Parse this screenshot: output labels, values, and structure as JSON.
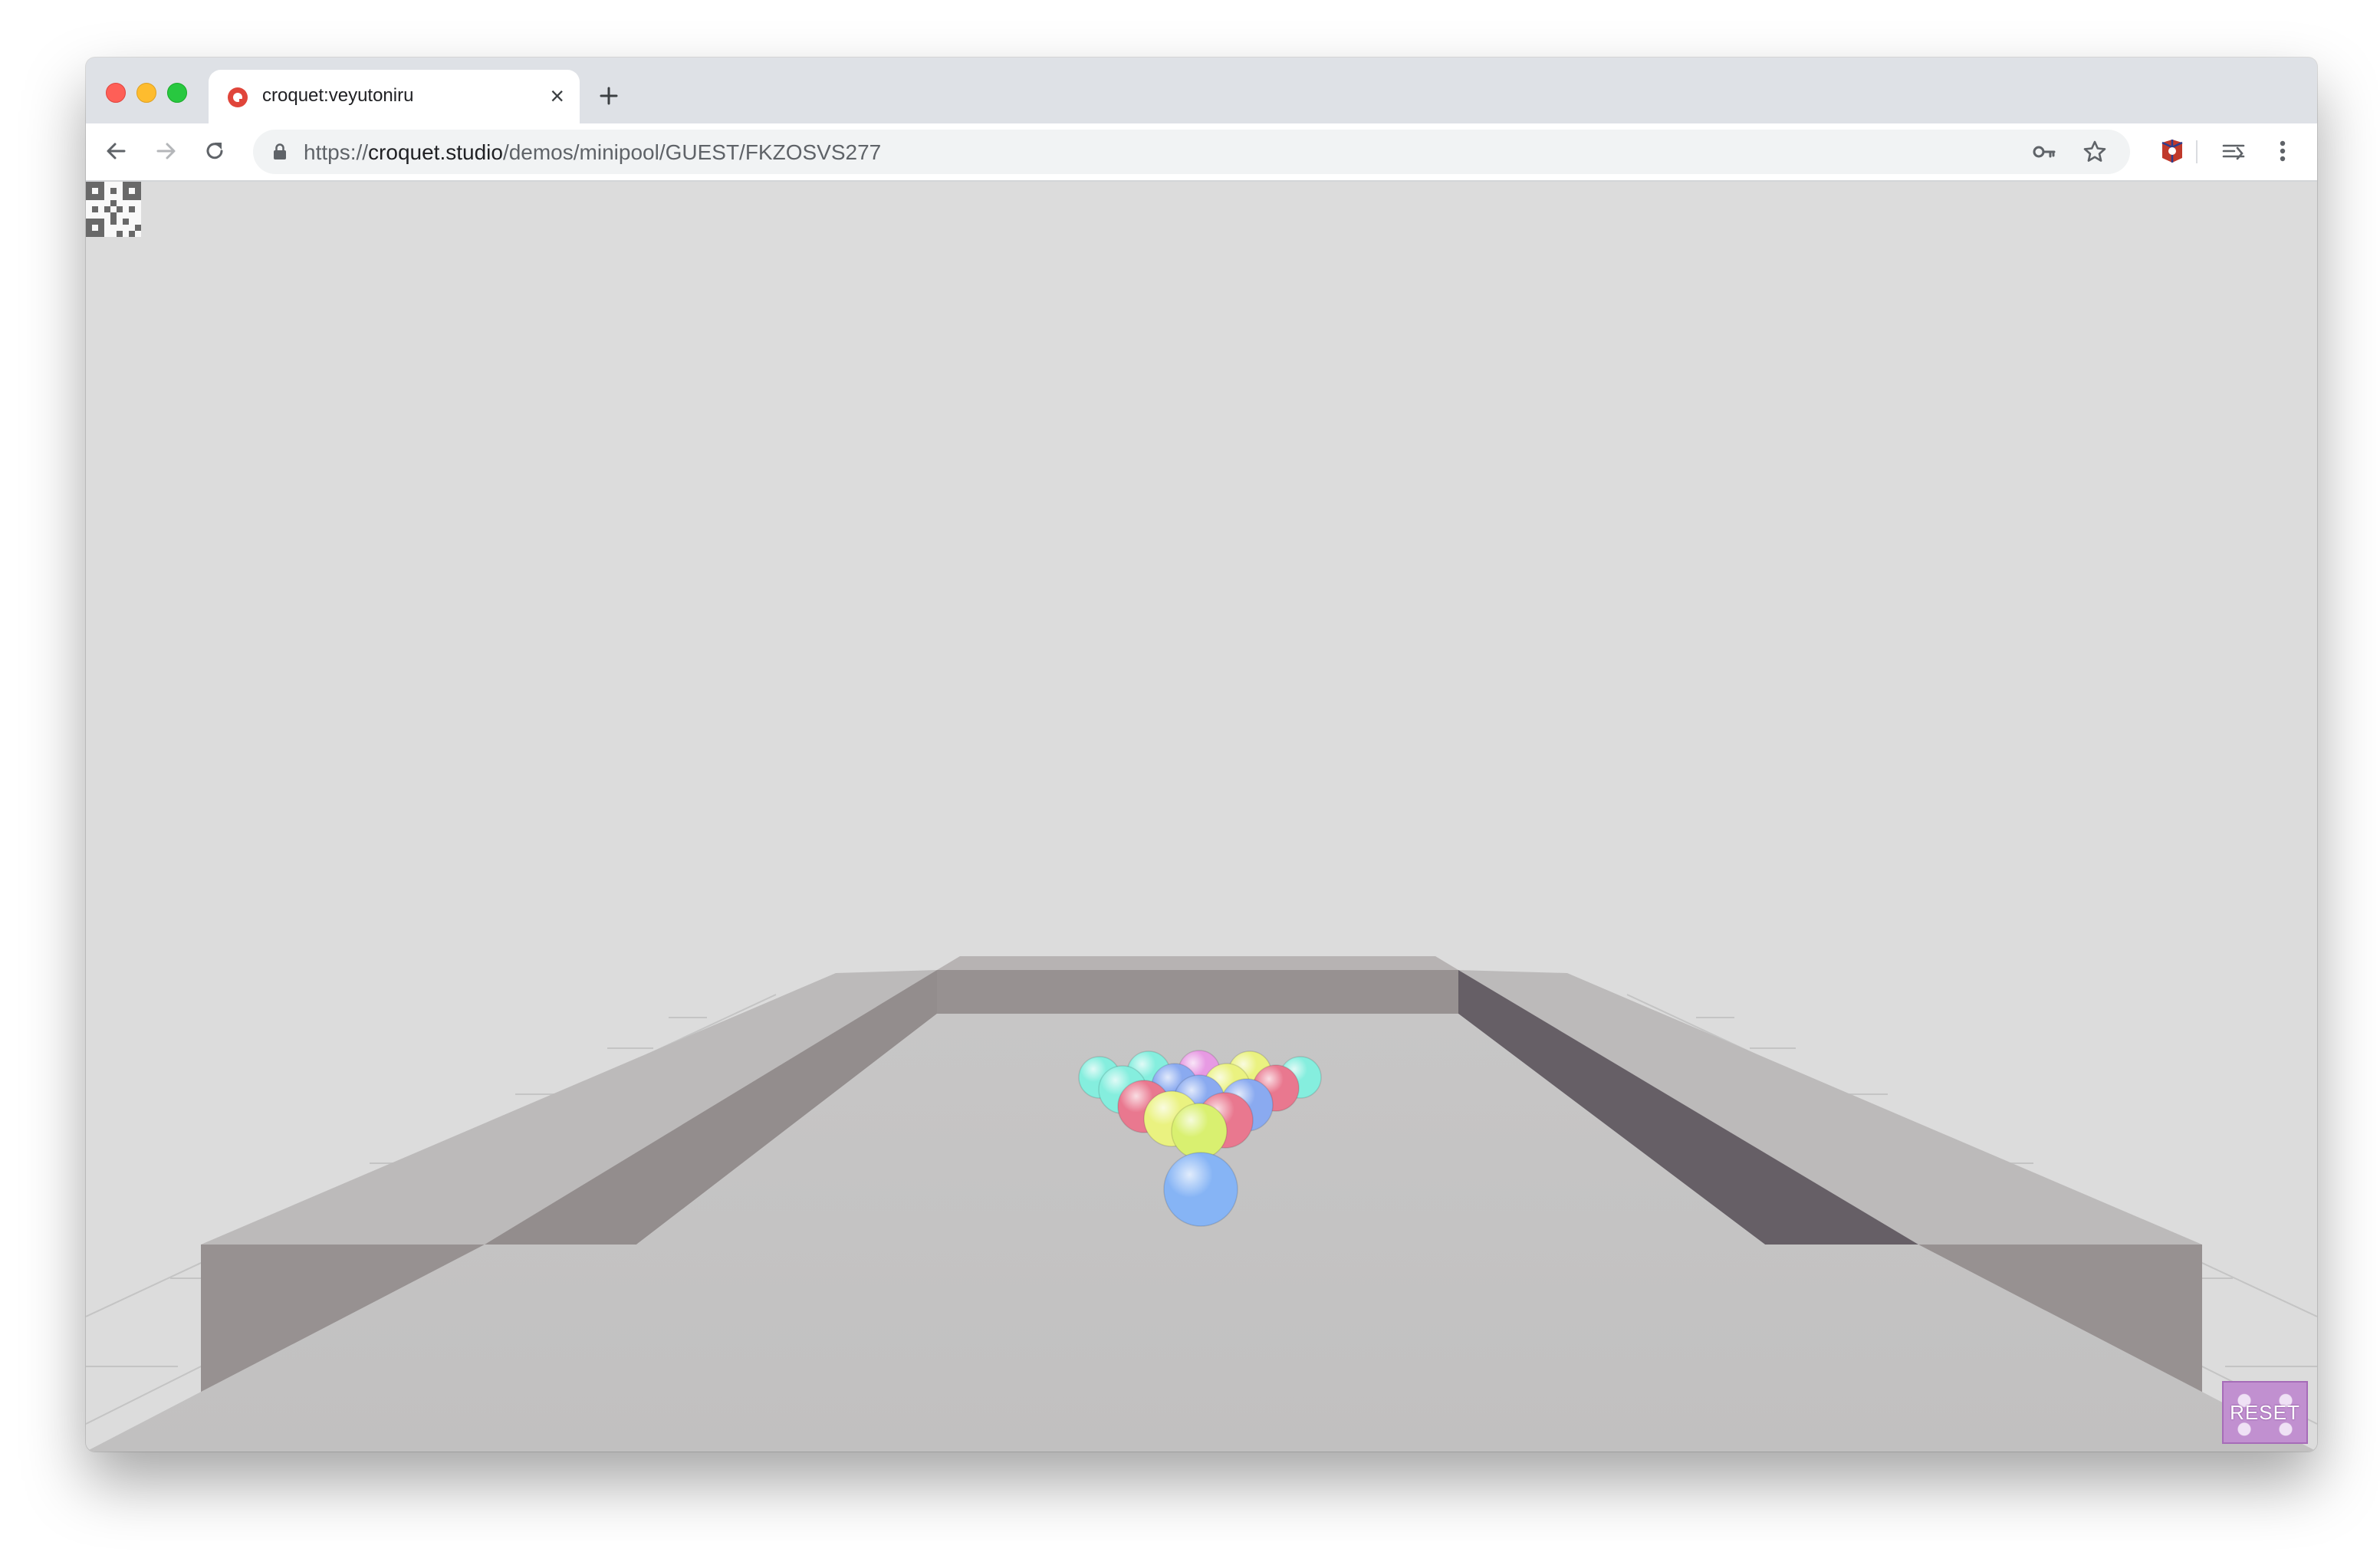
{
  "browser": {
    "tab": {
      "title": "croquet:veyutoniru",
      "favicon": "croquet-logo-icon"
    },
    "address_bar": {
      "scheme": "https://",
      "host": "croquet.studio",
      "path": "/demos/minipool/GUEST/FKZOSVS277"
    },
    "icons": [
      "back-arrow-icon",
      "forward-arrow-icon",
      "reload-icon",
      "lock-icon",
      "key-icon",
      "star-icon",
      "extension-icon",
      "reader-mode-icon",
      "kebab-menu-icon",
      "new-tab-icon",
      "tab-close-icon"
    ]
  },
  "scene": {
    "balls": [
      {
        "color": "#85eede",
        "row": 0
      },
      {
        "color": "#85eede",
        "row": 0
      },
      {
        "color": "#e79ae3",
        "row": 0
      },
      {
        "color": "#eaf280",
        "row": 0
      },
      {
        "color": "#85eede",
        "row": 0
      },
      {
        "color": "#85eede",
        "row": 1
      },
      {
        "color": "#8aaaf0",
        "row": 1
      },
      {
        "color": "#eaf280",
        "row": 1
      },
      {
        "color": "#e9788f",
        "row": 1
      },
      {
        "color": "#e9788f",
        "row": 2
      },
      {
        "color": "#8aaaf0",
        "row": 2
      },
      {
        "color": "#8aaaf0",
        "row": 2
      },
      {
        "color": "#eaf280",
        "row": 3
      },
      {
        "color": "#e9788f",
        "row": 3
      },
      {
        "color": "#d9f070",
        "row": 4
      },
      {
        "color": "#86b4f5",
        "role": "cue-ball"
      }
    ]
  },
  "overlay": {
    "reset_label": "RESET",
    "accent_color": "#c190d0"
  }
}
